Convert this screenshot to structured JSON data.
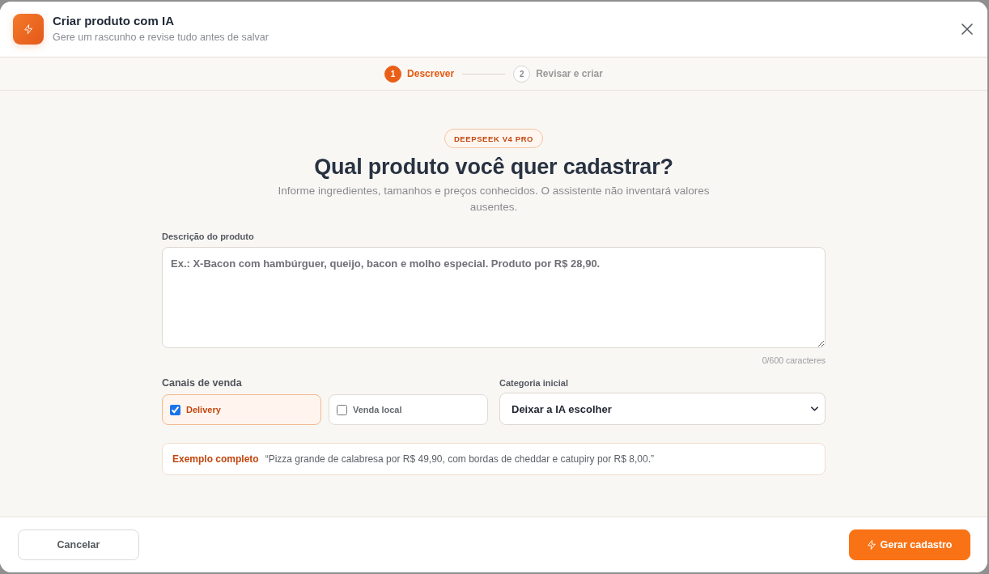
{
  "modal": {
    "title": "Criar produto com IA",
    "subtitle": "Gere um rascunho e revise tudo antes de salvar"
  },
  "steps": [
    {
      "number": "1",
      "label": "Descrever",
      "selected": true
    },
    {
      "number": "2",
      "label": "Revisar e criar",
      "selected": false
    }
  ],
  "intro": {
    "badge": "DEEPSEEK V4 PRO",
    "heading": "Qual produto você quer cadastrar?",
    "description": "Informe ingredientes, tamanhos e preços conhecidos. O assistente não inventará valores ausentes."
  },
  "description_field": {
    "label": "Descrição do produto",
    "placeholder": "Ex.: X-Bacon com hambúrguer, queijo, bacon e molho especial. Produto por R$ 28,90.",
    "counter": "0/600 caracteres"
  },
  "sales_channels": {
    "label": "Canais de venda",
    "options": [
      {
        "label": "Delivery",
        "checked": true
      },
      {
        "label": "Venda local",
        "checked": false
      }
    ]
  },
  "initial_category": {
    "label": "Categoria inicial",
    "value": "Deixar a IA escolher"
  },
  "example": {
    "label": "Exemplo completo",
    "text": "“Pizza grande de calabresa por R$ 49,90, com bordas de cheddar e catupiry por R$ 8,00.”"
  },
  "footer": {
    "buttons": [
      {
        "label": "Cancelar",
        "kind": "secondary"
      },
      {
        "label": "Gerar cadastro",
        "kind": "primary"
      }
    ]
  }
}
